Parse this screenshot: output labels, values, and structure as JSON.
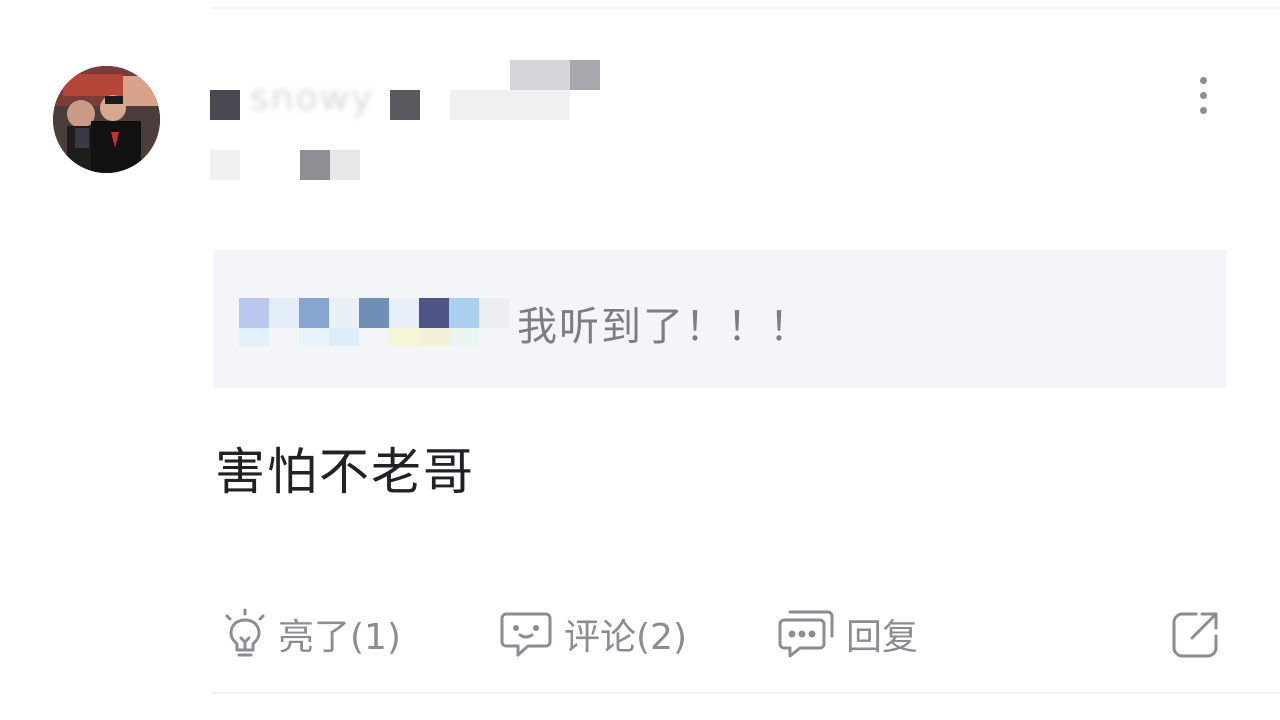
{
  "quote": {
    "text": "我听到了！！！"
  },
  "comment": {
    "text": "害怕不老哥"
  },
  "actions": {
    "like_label": "亮了(1)",
    "comment_label": "评论(2)",
    "reply_label": "回复"
  },
  "icons": {
    "like": "lightbulb-icon",
    "comment": "chat-bubble-icon",
    "reply": "double-chat-icon",
    "share": "share-icon",
    "more": "more-vertical-icon"
  },
  "colors": {
    "background": "#ffffff",
    "quote_background": "#f4f5f8",
    "primary_text": "#222226",
    "secondary_text": "#8c8c94"
  }
}
